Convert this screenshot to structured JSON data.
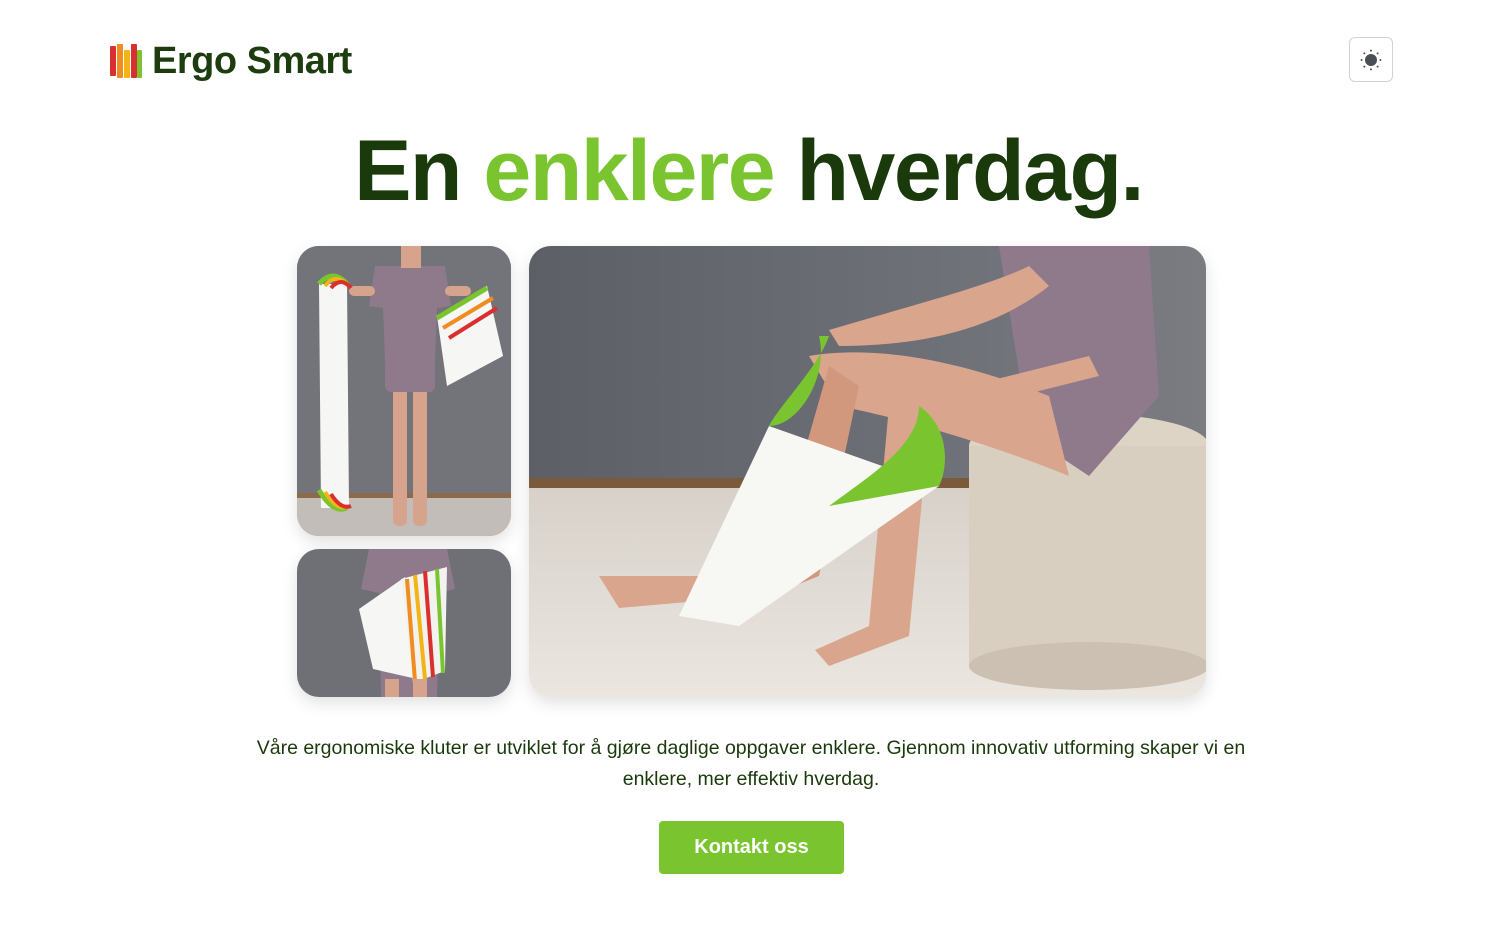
{
  "brand": {
    "name": "Ergo Smart",
    "logo_bar_colors": [
      "#d9302f",
      "#f08c20",
      "#f2b417",
      "#7ac52f"
    ]
  },
  "header": {
    "theme_toggle_icon": "sun-icon"
  },
  "hero": {
    "title_part1": "En ",
    "title_accent": "enklere",
    "title_part2": " hverdag.",
    "accent_color": "#7ac52f",
    "text_color": "#1a3a0c"
  },
  "gallery": {
    "images": [
      {
        "subject": "woman holding several ergonomic washcloths in both hands"
      },
      {
        "subject": "woman holding a stack of colorful ergonomic washcloths"
      },
      {
        "subject": "woman seated on a pouf using an ergonomic washcloth on her leg"
      }
    ]
  },
  "intro": {
    "text": "Våre ergonomiske kluter er utviklet for å gjøre daglige oppgaver enklere. Gjennom innovativ utforming skaper vi en enklere, mer effektiv hverdag."
  },
  "cta": {
    "label": "Kontakt oss",
    "color": "#7ac52f"
  }
}
